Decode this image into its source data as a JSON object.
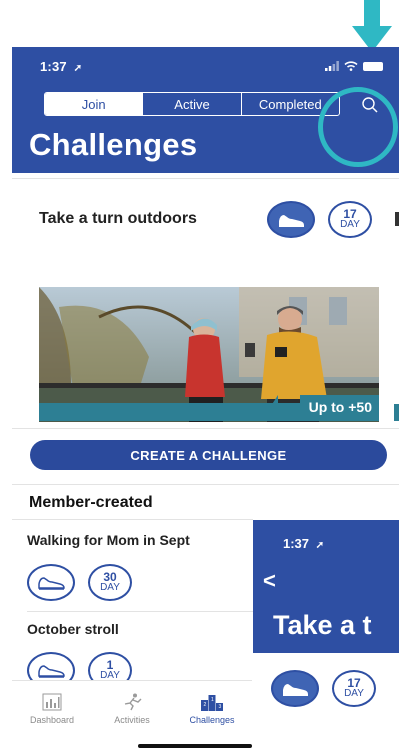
{
  "status": {
    "time": "1:37"
  },
  "segments": [
    {
      "label": "Join",
      "active": true
    },
    {
      "label": "Active",
      "active": false
    },
    {
      "label": "Completed",
      "active": false
    }
  ],
  "page_title": "Challenges",
  "featured": {
    "title": "Take a turn outdoors",
    "day_count": "17",
    "day_unit": "DAY",
    "reward": "Up to +50"
  },
  "create_button": "CREATE A CHALLENGE",
  "member_section": {
    "title": "Member-created",
    "items": [
      {
        "title": "Walking for Mom in Sept",
        "day_count": "30",
        "day_unit": "DAY"
      },
      {
        "title": "October stroll",
        "day_count": "1",
        "day_unit": "DAY"
      }
    ]
  },
  "tabs": [
    {
      "label": "Dashboard",
      "icon": "bar-chart-icon",
      "active": false
    },
    {
      "label": "Activities",
      "icon": "runner-icon",
      "active": false
    },
    {
      "label": "Challenges",
      "icon": "podium-icon",
      "active": true
    }
  ],
  "overlay": {
    "time": "1:37",
    "title": "Take a t",
    "day_count": "17",
    "day_unit": "DAY"
  },
  "colors": {
    "brand": "#2e4fa3",
    "annotation": "#2fb8c4",
    "reward_teal": "#2d7f94"
  }
}
